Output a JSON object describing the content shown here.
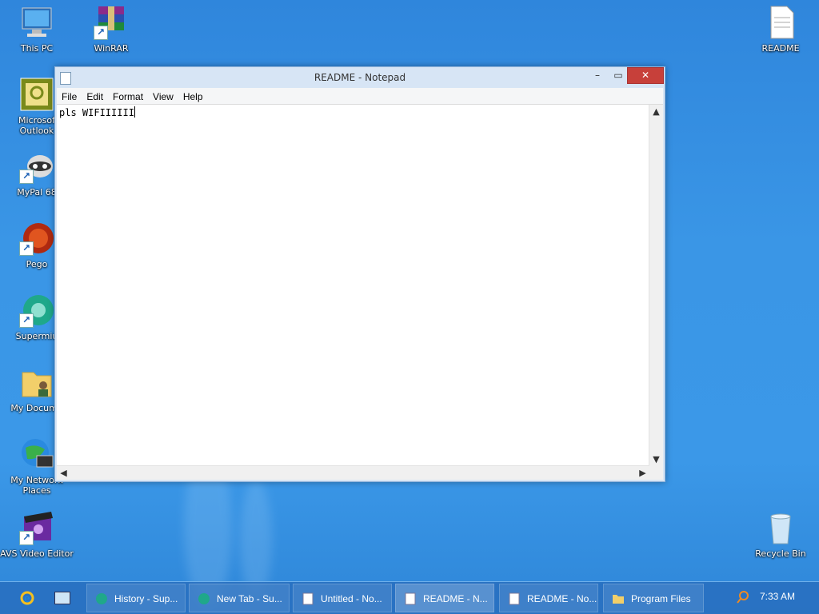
{
  "desktop": {
    "icons": [
      {
        "label": "This PC"
      },
      {
        "label": "WinRAR"
      },
      {
        "label": "README"
      },
      {
        "label": "Microsof Outlook"
      },
      {
        "label": "MyPal 68"
      },
      {
        "label": "Pego"
      },
      {
        "label": "Supermiu"
      },
      {
        "label": "My Docume"
      },
      {
        "label": "My Network Places"
      },
      {
        "label": "AVS Video Editor"
      },
      {
        "label": "Recycle Bin"
      }
    ]
  },
  "notepad": {
    "title": "README - Notepad",
    "menu": [
      "File",
      "Edit",
      "Format",
      "View",
      "Help"
    ],
    "content": "pls WIFIIIIII"
  },
  "taskbar": {
    "items": [
      {
        "label": "History - Sup..."
      },
      {
        "label": "New Tab - Su..."
      },
      {
        "label": "Untitled - No..."
      },
      {
        "label": "README - N..."
      },
      {
        "label": "README - No..."
      },
      {
        "label": "Program Files"
      }
    ],
    "time": "7:33 AM"
  }
}
